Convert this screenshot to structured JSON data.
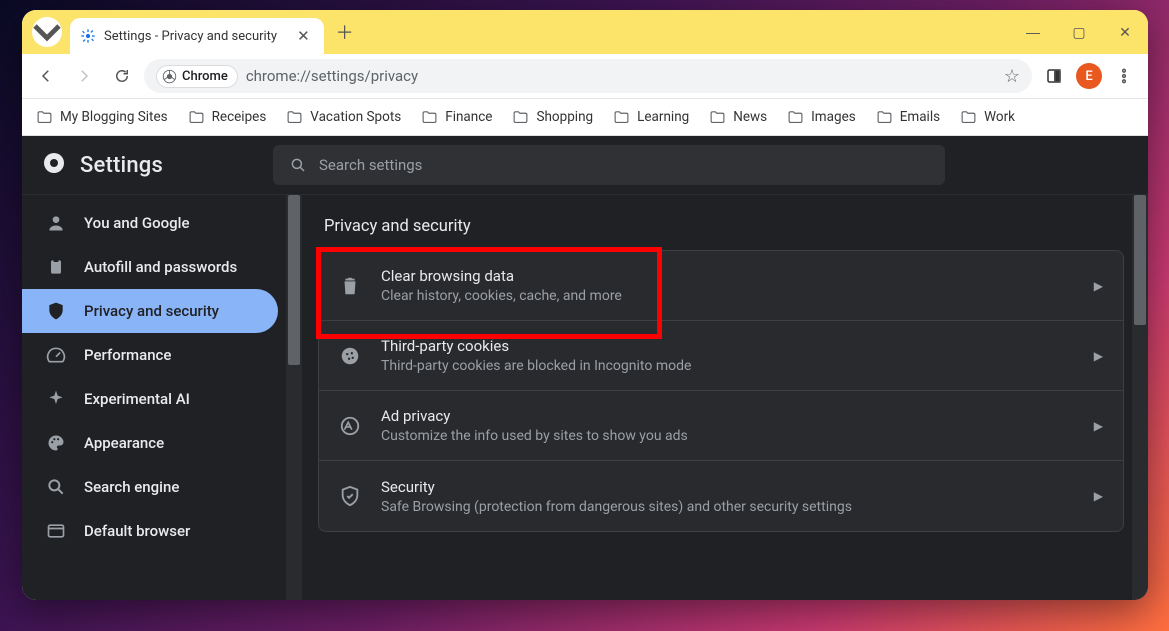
{
  "tab": {
    "title": "Settings - Privacy and security"
  },
  "omnibox": {
    "label": "Chrome",
    "url": "chrome://settings/privacy"
  },
  "profile_initial": "E",
  "bookmarks": [
    "My Blogging Sites",
    "Receipes",
    "Vacation Spots",
    "Finance",
    "Shopping",
    "Learning",
    "News",
    "Images",
    "Emails",
    "Work"
  ],
  "settings": {
    "title": "Settings",
    "search_placeholder": "Search settings",
    "sidebar": [
      {
        "label": "You and Google"
      },
      {
        "label": "Autofill and passwords"
      },
      {
        "label": "Privacy and security",
        "active": true
      },
      {
        "label": "Performance"
      },
      {
        "label": "Experimental AI"
      },
      {
        "label": "Appearance"
      },
      {
        "label": "Search engine"
      },
      {
        "label": "Default browser"
      }
    ],
    "section_title": "Privacy and security",
    "rows": [
      {
        "title": "Clear browsing data",
        "desc": "Clear history, cookies, cache, and more"
      },
      {
        "title": "Third-party cookies",
        "desc": "Third-party cookies are blocked in Incognito mode"
      },
      {
        "title": "Ad privacy",
        "desc": "Customize the info used by sites to show you ads"
      },
      {
        "title": "Security",
        "desc": "Safe Browsing (protection from dangerous sites) and other security settings"
      }
    ]
  }
}
